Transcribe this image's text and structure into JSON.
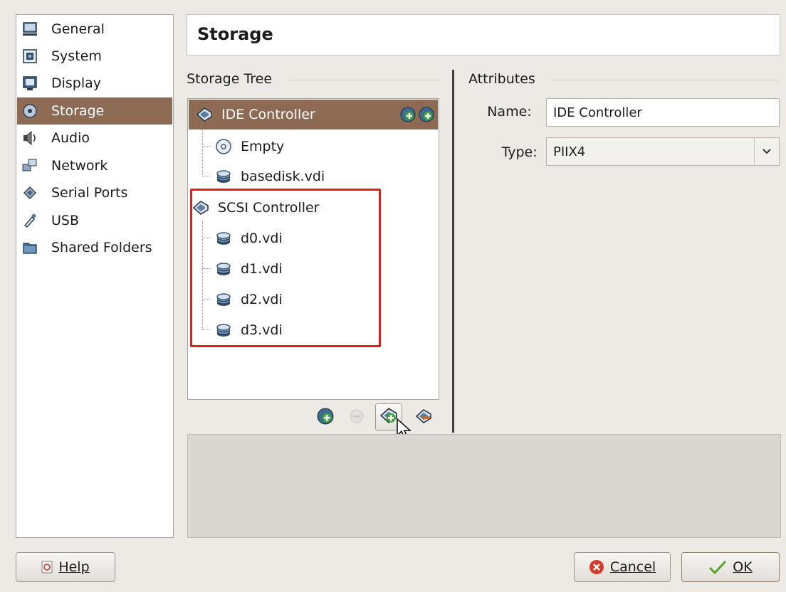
{
  "nav": {
    "items": [
      {
        "label": "General",
        "icon": "monitor-icon"
      },
      {
        "label": "System",
        "icon": "chip-icon"
      },
      {
        "label": "Display",
        "icon": "display-icon"
      },
      {
        "label": "Storage",
        "icon": "storage-icon",
        "selected": true
      },
      {
        "label": "Audio",
        "icon": "speaker-icon"
      },
      {
        "label": "Network",
        "icon": "network-icon"
      },
      {
        "label": "Serial Ports",
        "icon": "serial-port-icon"
      },
      {
        "label": "USB",
        "icon": "usb-icon"
      },
      {
        "label": "Shared Folders",
        "icon": "folder-icon"
      }
    ]
  },
  "page_title": "Storage",
  "storage_tree": {
    "label": "Storage Tree",
    "controllers": [
      {
        "label": "IDE Controller",
        "children": [
          "Empty",
          "basedisk.vdi"
        ]
      },
      {
        "label": "SCSI Controller",
        "children": [
          "d0.vdi",
          "d1.vdi",
          "d2.vdi",
          "d3.vdi"
        ]
      }
    ]
  },
  "attributes": {
    "label": "Attributes",
    "name_label": "Name:",
    "name_value": "IDE Controller",
    "type_label": "Type:",
    "type_value": "PIIX4"
  },
  "buttons": {
    "help": "Help",
    "cancel": "Cancel",
    "ok": "OK"
  },
  "colors": {
    "selection": "#8c6a53",
    "highlight_border": "#e01b1b"
  }
}
